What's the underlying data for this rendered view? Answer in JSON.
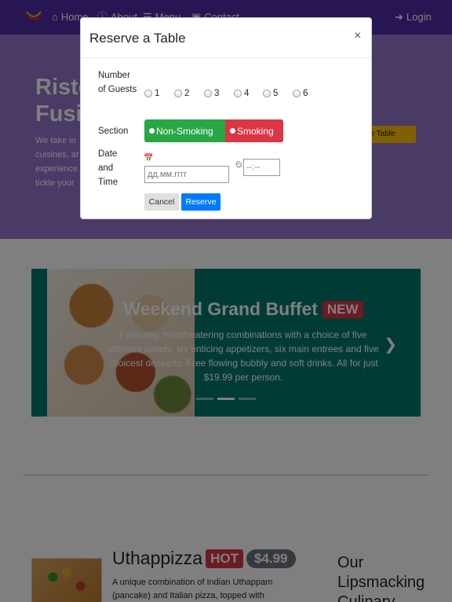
{
  "navbar": {
    "items": [
      {
        "label": "Home",
        "icon": "home-icon"
      },
      {
        "label": "About",
        "icon": "info-icon"
      },
      {
        "label": "Menu",
        "icon": "list-icon"
      },
      {
        "label": "Contact",
        "icon": "address-card-icon"
      }
    ],
    "login": {
      "label": "Login",
      "icon": "sign-in-icon"
    }
  },
  "jumbotron": {
    "title": "Risto Fusio",
    "text": "We take in cuisines, ar experience tickle your",
    "reserve_label": "ve Table"
  },
  "carousel": {
    "title": "Weekend Grand Buffet",
    "badge": "NEW",
    "text": "Featuring mouthwatering combinations with a choice of five different salads, six enticing appetizers, six main entrees and five choicest desserts. Free flowing bubbly and soft drinks. All for just $19.99 per person."
  },
  "dish": {
    "name": "Uthappizza",
    "hot": "HOT",
    "price": "$4.99",
    "description": "A unique combination of Indian Uthappam (pancake) and Italian pizza, topped with"
  },
  "side": {
    "title": "Our Lipsmacking Culinary"
  },
  "modal": {
    "title": "Reserve a Table",
    "close": "×",
    "guests_label": "Number of Guests",
    "guest_options": [
      "1",
      "2",
      "3",
      "4",
      "5",
      "6"
    ],
    "section_label": "Section",
    "non_smoking_label": "Non-Smoking",
    "smoking_label": "Smoking",
    "datetime_label": "Date and Time",
    "date_placeholder": "дд.мм.гггг",
    "time_placeholder": "--:--",
    "cancel_label": "Cancel",
    "reserve_label": "Reserve"
  },
  "colors": {
    "navbar": "#512da8",
    "jumbotron": "#9575cd",
    "carousel": "#00796b",
    "non_smoking": "#28a745",
    "smoking": "#dc3545",
    "primary": "#007bff"
  }
}
